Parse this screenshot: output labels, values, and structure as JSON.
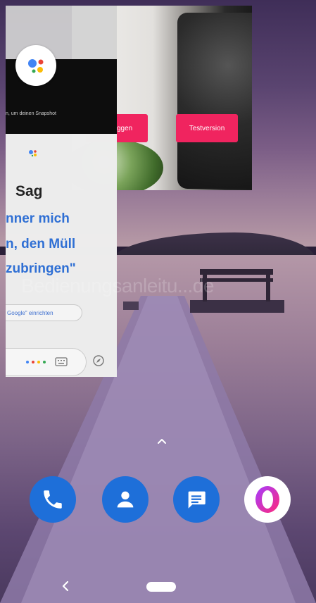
{
  "camera_app": {
    "login_label": "Einloggen",
    "trial_label": "Testversion",
    "accent_color": "#f0245f"
  },
  "assistant": {
    "topbar_snippet": "n, um deinen Snapshot",
    "heading": "Sag",
    "phrases": [
      "nner mich",
      "n, den Müll",
      "zubringen\""
    ],
    "setup_chip": "Google\" einrichten",
    "accent_color": "#2f6fd4"
  },
  "watermark": "Bedienungsanleitu...de",
  "dock": {
    "apps": [
      {
        "icon": "phone-icon"
      },
      {
        "icon": "contacts-icon"
      },
      {
        "icon": "messages-icon"
      },
      {
        "icon": "opera-icon"
      }
    ]
  },
  "navigation": {
    "back_icon": "back-chevron-icon",
    "home_icon": "home-pill-icon"
  }
}
